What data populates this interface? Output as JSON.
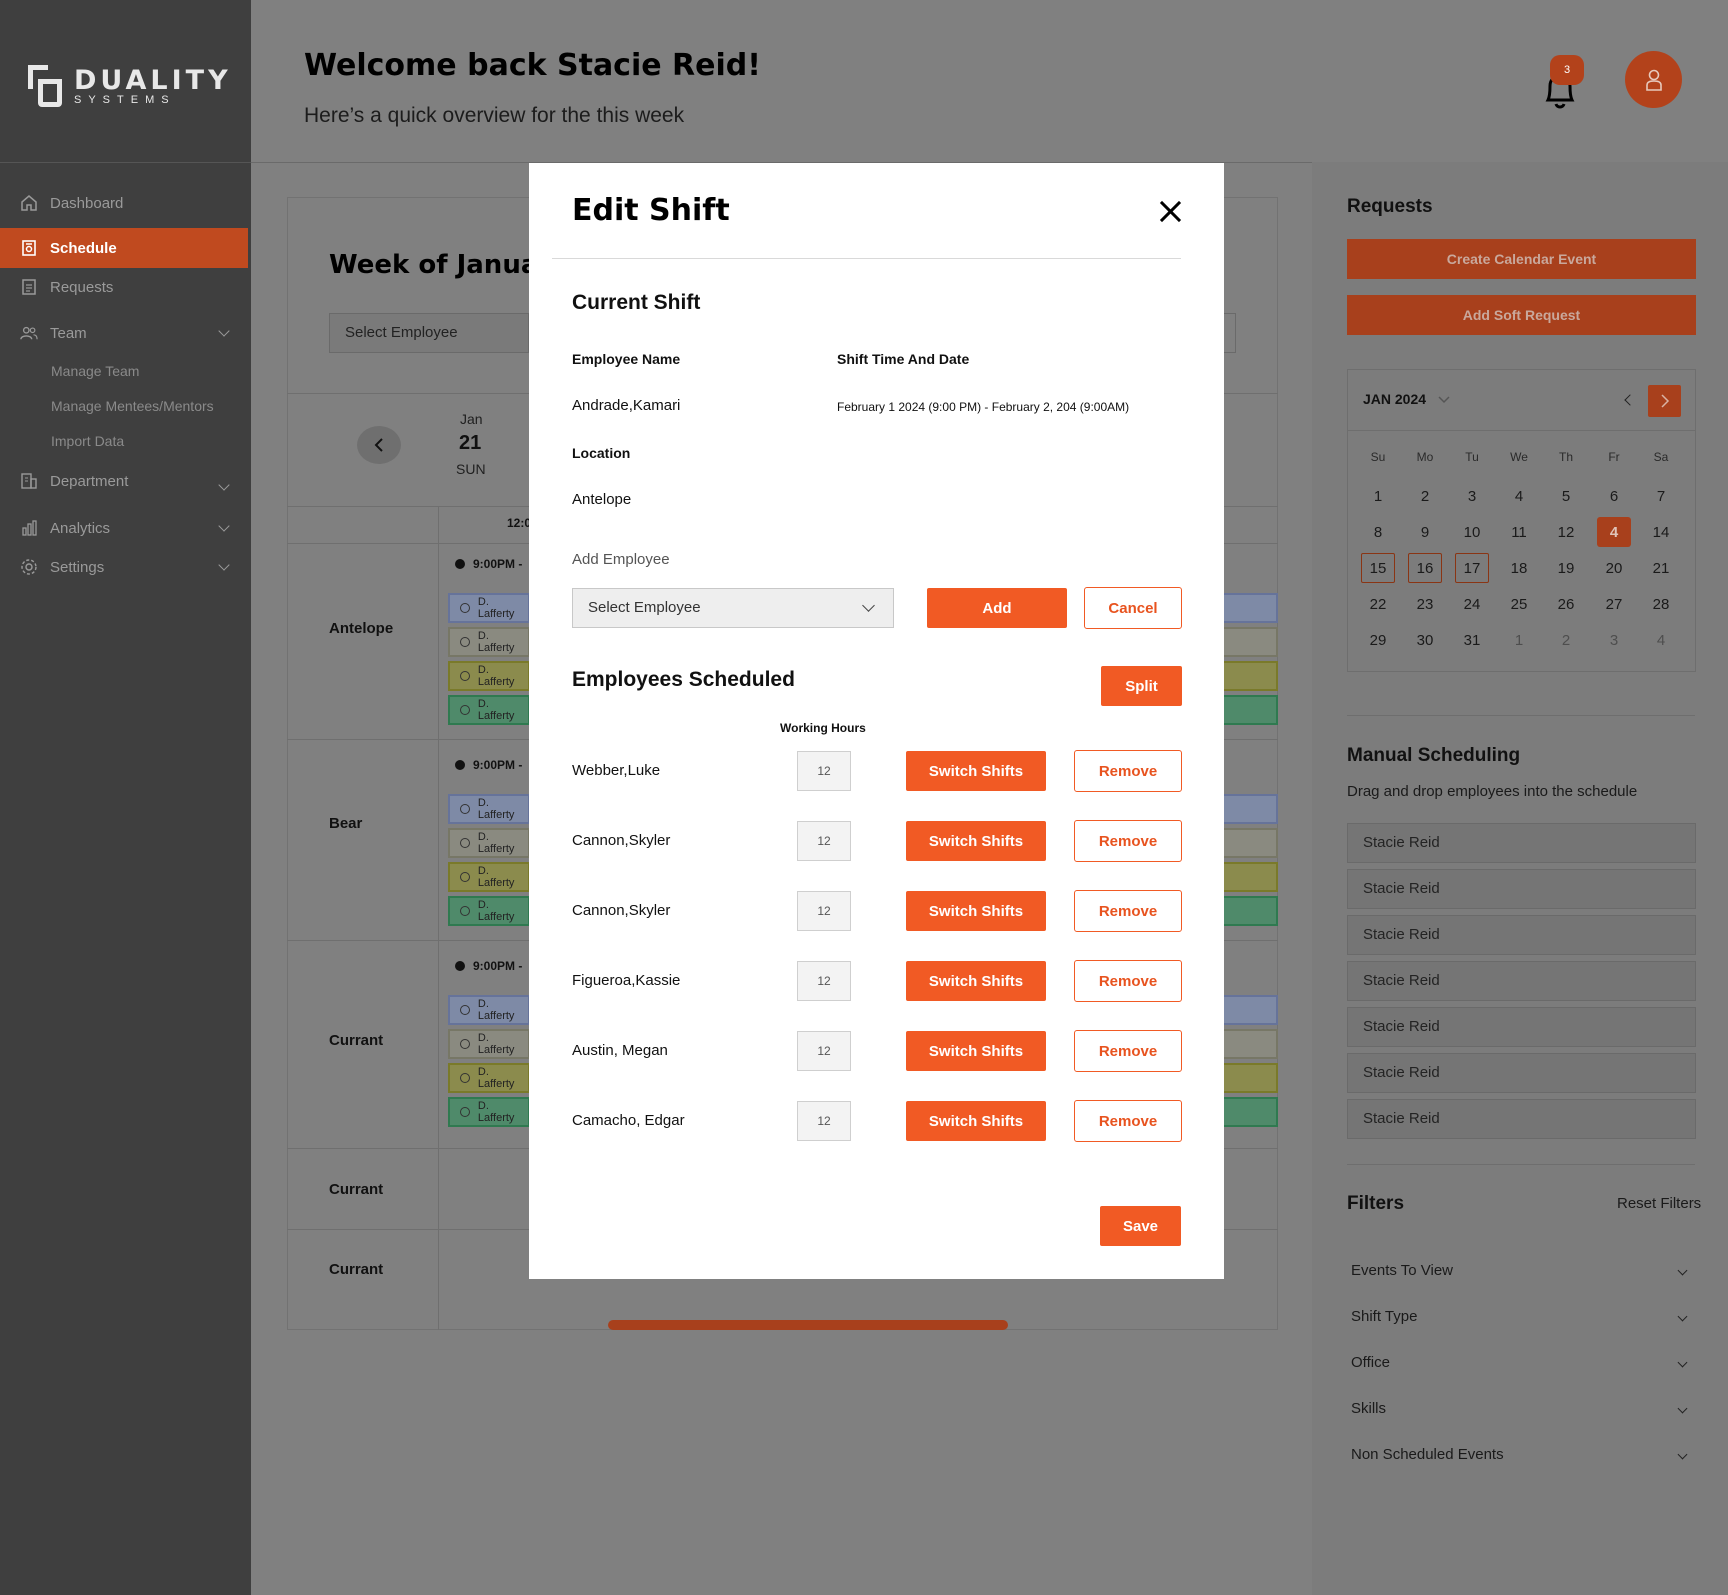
{
  "brand": {
    "name": "DUALITY",
    "tagline": "SYSTEMS"
  },
  "sidebar": {
    "items": [
      {
        "label": "Dashboard",
        "icon": "home-icon"
      },
      {
        "label": "Schedule",
        "icon": "schedule-icon",
        "active": true
      },
      {
        "label": "Requests",
        "icon": "clipboard-icon"
      },
      {
        "label": "Team",
        "icon": "users-icon",
        "expandable": true
      },
      {
        "label": "Department",
        "icon": "building-icon",
        "expandable": true
      },
      {
        "label": "Analytics",
        "icon": "chart-icon",
        "expandable": true
      },
      {
        "label": "Settings",
        "icon": "gear-icon",
        "expandable": true
      }
    ],
    "team_sub": [
      "Manage Team",
      "Manage Mentees/Mentors",
      "Import Data"
    ]
  },
  "header": {
    "title": "Welcome back Stacie Reid!",
    "subtitle": "Here’s a quick overview for the this week",
    "notification_count": "3"
  },
  "schedule": {
    "title": "Week of January",
    "employee_select": "Select Employee",
    "day": {
      "month": "Jan",
      "num": "21",
      "dow": "SUN"
    },
    "time_header": "12:0",
    "locations": [
      {
        "name": "Antelope",
        "time": "9:00PM -"
      },
      {
        "name": "Bear",
        "time": "9:00PM -"
      },
      {
        "name": "Currant",
        "time": "9:00PM -"
      },
      {
        "name": "Currant"
      },
      {
        "name": "Currant"
      }
    ],
    "chip_label": "D. Lafferty"
  },
  "right_panel": {
    "requests_title": "Requests",
    "create_event": "Create Calendar Event",
    "add_soft_request": "Add Soft Request",
    "calendar": {
      "month_label": "JAN 2024",
      "dows": [
        "Su",
        "Mo",
        "Tu",
        "We",
        "Th",
        "Fr",
        "Sa"
      ],
      "weeks": [
        [
          "1",
          "2",
          "3",
          "4",
          "5",
          "6",
          "7"
        ],
        [
          "8",
          "9",
          "10",
          "11",
          "12",
          "4",
          "14"
        ],
        [
          "15",
          "16",
          "17",
          "18",
          "19",
          "20",
          "21"
        ],
        [
          "22",
          "23",
          "24",
          "25",
          "26",
          "27",
          "28"
        ],
        [
          "29",
          "30",
          "31",
          "1",
          "2",
          "3",
          "4"
        ]
      ],
      "selected_day": "4",
      "highlighted_days": [
        "15",
        "16",
        "17"
      ],
      "accent": "#a8401c"
    },
    "manual_title": "Manual Scheduling",
    "manual_sub": "Drag and drop employees into the schedule",
    "staff": [
      "Stacie Reid",
      "Stacie Reid",
      "Stacie Reid",
      "Stacie Reid",
      "Stacie Reid",
      "Stacie Reid",
      "Stacie Reid"
    ],
    "filters_title": "Filters",
    "reset_filters": "Reset Filters",
    "filters": [
      "Events To View",
      "Shift Type",
      "Office",
      "Skills",
      "Non Scheduled Events"
    ]
  },
  "modal": {
    "title": "Edit Shift",
    "current_shift_title": "Current Shift",
    "employee_name_label": "Employee Name",
    "employee_name": "Andrade,Kamari",
    "shift_time_label": "Shift Time And Date",
    "shift_time": "February 1 2024 (9:00 PM) - February 2, 204 (9:00AM)",
    "location_label": "Location",
    "location": "Antelope",
    "add_employee_label": "Add Employee",
    "select_placeholder": "Select Employee",
    "add_button": "Add",
    "cancel_button": "Cancel",
    "scheduled_title": "Employees Scheduled",
    "split_button": "Split",
    "working_hours_label": "Working Hours",
    "switch_label": "Switch Shifts",
    "remove_label": "Remove",
    "employees": [
      {
        "name": "Webber,Luke",
        "hours": "12"
      },
      {
        "name": "Cannon,Skyler",
        "hours": "12"
      },
      {
        "name": "Cannon,Skyler",
        "hours": "12"
      },
      {
        "name": "Figueroa,Kassie",
        "hours": "12"
      },
      {
        "name": "Austin, Megan",
        "hours": "12"
      },
      {
        "name": "Camacho, Edgar",
        "hours": "12"
      }
    ],
    "save_button": "Save",
    "accent": "#f15a24"
  }
}
